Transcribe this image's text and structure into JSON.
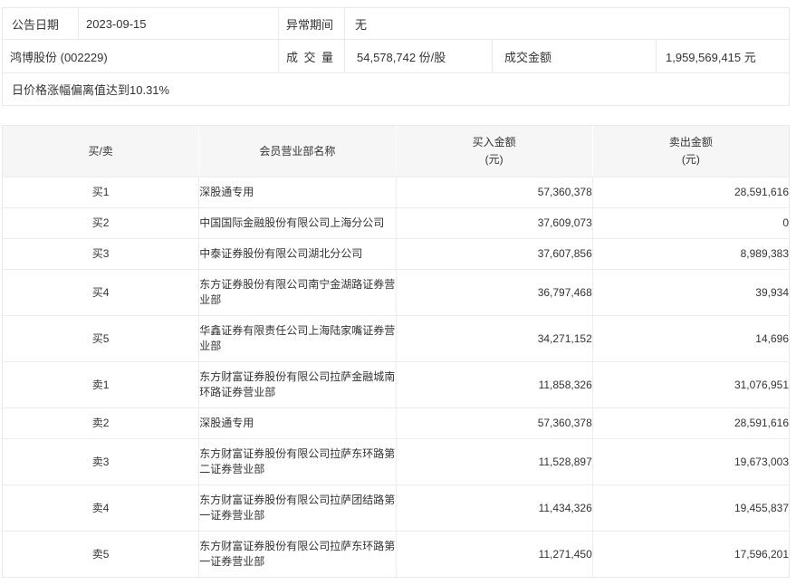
{
  "info": {
    "announce_date_label": "公告日期",
    "announce_date": "2023-09-15",
    "abnormal_period_label": "异常期间",
    "abnormal_period": "无",
    "stock_name_code": "鸿博股份 (002229)",
    "volume_label": "成交量",
    "volume_value": "54,578,742 份/股",
    "turnover_label": "成交金额",
    "turnover_value": "1,959,569,415 元",
    "list_reason": "日价格涨幅偏离值达到10.31%"
  },
  "table": {
    "columns": [
      {
        "label": "买/卖",
        "sub": ""
      },
      {
        "label": "会员营业部名称",
        "sub": ""
      },
      {
        "label": "买入金额",
        "sub": "(元)"
      },
      {
        "label": "卖出金额",
        "sub": "(元)"
      }
    ],
    "rows": [
      {
        "side": "买1",
        "name": "深股通专用",
        "buy": "57,360,378",
        "sell": "28,591,616"
      },
      {
        "side": "买2",
        "name": "中国国际金融股份有限公司上海分公司",
        "buy": "37,609,073",
        "sell": "0"
      },
      {
        "side": "买3",
        "name": "中泰证券股份有限公司湖北分公司",
        "buy": "37,607,856",
        "sell": "8,989,383"
      },
      {
        "side": "买4",
        "name": "东方证券股份有限公司南宁金湖路证券营业部",
        "buy": "36,797,468",
        "sell": "39,934"
      },
      {
        "side": "买5",
        "name": "华鑫证券有限责任公司上海陆家嘴证券营业部",
        "buy": "34,271,152",
        "sell": "14,696"
      },
      {
        "side": "卖1",
        "name": "东方财富证券股份有限公司拉萨金融城南环路证券营业部",
        "buy": "11,858,326",
        "sell": "31,076,951"
      },
      {
        "side": "卖2",
        "name": "深股通专用",
        "buy": "57,360,378",
        "sell": "28,591,616"
      },
      {
        "side": "卖3",
        "name": "东方财富证券股份有限公司拉萨东环路第二证券营业部",
        "buy": "11,528,897",
        "sell": "19,673,003"
      },
      {
        "side": "卖4",
        "name": "东方财富证券股份有限公司拉萨团结路第一证券营业部",
        "buy": "11,434,326",
        "sell": "19,455,837"
      },
      {
        "side": "卖5",
        "name": "东方财富证券股份有限公司拉萨东环路第一证券营业部",
        "buy": "11,271,450",
        "sell": "17,596,201"
      }
    ],
    "colors": {
      "header_bg": "#f6f6f6",
      "border": "#e9e9e9",
      "inner_border": "#ececec",
      "text": "#333333"
    }
  }
}
